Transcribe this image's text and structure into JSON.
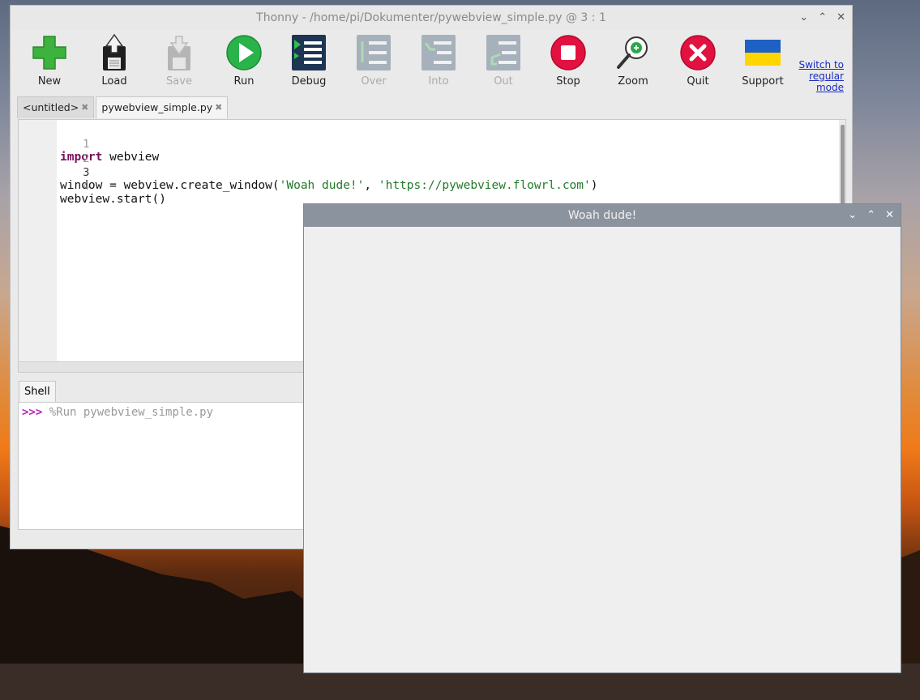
{
  "thonny": {
    "title": "Thonny  -  /home/pi/Dokumenter/pywebview_simple.py  @  3 : 1",
    "controls": {
      "minimize": "⌄",
      "maximize": "⌃",
      "close": "✕"
    },
    "toolbar": {
      "new": "New",
      "load": "Load",
      "save": "Save",
      "run": "Run",
      "debug": "Debug",
      "over": "Over",
      "into": "Into",
      "out": "Out",
      "stop": "Stop",
      "zoom": "Zoom",
      "quit": "Quit",
      "support": "Support"
    },
    "switch_mode": {
      "line1": "Switch to",
      "line2": "regular",
      "line3": "mode"
    },
    "tabs": [
      {
        "label": "<untitled>",
        "close": "✖"
      },
      {
        "label": "pywebview_simple.py",
        "close": "✖"
      }
    ],
    "editor": {
      "line_numbers": [
        "1",
        "2",
        "3",
        "4"
      ],
      "line1": {
        "kw": "import",
        "rest": " webview"
      },
      "line3": {
        "pre": "window = webview.create_window(",
        "s1": "'Woah dude!'",
        "mid": ", ",
        "s2": "'https://pywebview.flowrl.com'",
        "post": ")"
      },
      "line4": "webview.start()"
    },
    "shell": {
      "tab_label": "Shell",
      "prompt": ">>>",
      "command": " %Run pywebview_simple.py"
    }
  },
  "webview": {
    "title": "Woah dude!",
    "controls": {
      "minimize": "⌄",
      "maximize": "⌃",
      "close": "✕"
    }
  },
  "colors": {
    "keyword": "#7a0f5e",
    "string": "#227a2a",
    "prompt": "#c11eb8",
    "webview_titlebar": "#8b939e"
  }
}
